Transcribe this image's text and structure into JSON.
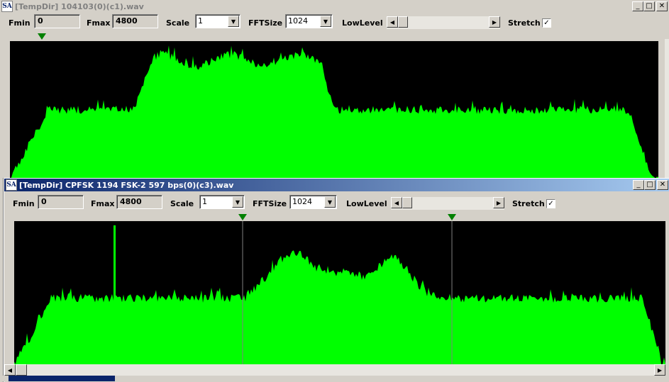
{
  "window1": {
    "title_icon": "SA",
    "title": "[TempDir] 104103(0)(c1).wav",
    "fmin_label": "Fmin",
    "fmin_value": "0",
    "fmax_label": "Fmax",
    "fmax_value": "4800",
    "scale_label": "Scale",
    "scale_value": "1",
    "fftsize_label": "FFTSize",
    "fftsize_value": "1024",
    "lowlevel_label": "LowLevel",
    "lowlevel_level": 0.03,
    "stretch_label": "Stretch",
    "stretch_checked": "✓"
  },
  "window2": {
    "title_icon": "SA",
    "title": "[TempDir] CPFSK 1194 FSK-2 597 bps(0)(c3).wav",
    "fmin_label": "Fmin",
    "fmin_value": "0",
    "fmax_label": "Fmax",
    "fmax_value": "4800",
    "scale_label": "Scale",
    "scale_value": "1",
    "fftsize_label": "FFTSize",
    "fftsize_value": "1024",
    "lowlevel_label": "LowLevel",
    "lowlevel_level": 0.03,
    "stretch_label": "Stretch",
    "stretch_checked": "✓"
  },
  "window_buttons": {
    "minimize": "_",
    "maximize": "□",
    "close": "✕"
  },
  "colors": {
    "spectrum_fill": "#00ff00",
    "background": "#000000",
    "marker": "#008000",
    "active_title": "#0a246a"
  },
  "icons": [
    "app-icon",
    "minimize-icon",
    "maximize-icon",
    "close-icon",
    "dropdown-arrow-icon",
    "scroll-left-icon",
    "scroll-right-icon",
    "frequency-marker-icon"
  ]
}
